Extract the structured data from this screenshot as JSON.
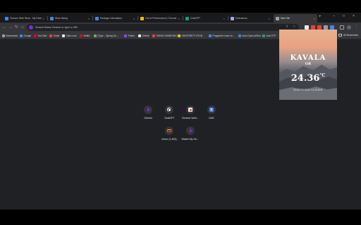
{
  "tabs": [
    {
      "title": "Chrome Web Store - My Exten",
      "color": "#4285f4",
      "active": false
    },
    {
      "title": "Store listing",
      "color": "#4285f4",
      "active": false
    },
    {
      "title": "Package information",
      "color": "#4285f4",
      "active": false
    },
    {
      "title": "Out of Performance | Chrome",
      "color": "#fbbc04",
      "active": false
    },
    {
      "title": "ChatGPT",
      "color": "#10a37f",
      "active": false
    },
    {
      "title": "Extensions",
      "color": "#8ab4f8",
      "active": false
    },
    {
      "title": "New Tab",
      "color": "#9aa0a6",
      "active": true
    }
  ],
  "toolbar": {
    "back": "←",
    "forward": "→",
    "reload": "↻",
    "home": "⌂",
    "omnibox_placeholder": "Search Brave Search or type a URL",
    "share_icon": "⇪",
    "star_icon": "☆",
    "menu_icon": "⋮"
  },
  "extensions": [
    "#e8eaed",
    "#ea4335",
    "#ea4335",
    "#9aa0a6",
    "#4285f4"
  ],
  "bookmarks": [
    {
      "label": "Bookmarks",
      "color": "#9aa0a6"
    },
    {
      "label": "Google",
      "color": "#4285f4"
    },
    {
      "label": "YouTube",
      "color": "#ff0000"
    },
    {
      "label": "Gmail",
      "color": "#ea4335"
    },
    {
      "label": "Claro.com",
      "color": "#e8eaed"
    },
    {
      "label": "Netflix",
      "color": "#e50914"
    },
    {
      "label": "[Type – Spring Gu…",
      "color": "#6db33f"
    },
    {
      "label": "Twitch",
      "color": "#9146ff"
    },
    {
      "label": "GitHub",
      "color": "#e8eaed"
    },
    {
      "label": "TAINIA VIVARIONG…",
      "color": "#ea4335"
    },
    {
      "label": "UNIVERSITY STUD…",
      "color": "#fbbc04"
    },
    {
      "label": "Programiz Learn to…",
      "color": "#4285f4"
    },
    {
      "label": "Ionic Open-uElect…",
      "color": "#3880ff"
    },
    {
      "label": "chat GTP",
      "color": "#10a37f"
    }
  ],
  "all_bookmarks": "All Bookmarks",
  "weather": {
    "city": "KAVALA",
    "country": "GR",
    "temp": "24.36",
    "unit": "°C",
    "condition": "SCATTERED CLOUDS"
  },
  "shortcuts": [
    {
      "label": "Gemini",
      "icon": "play-icon"
    },
    {
      "label": "ChatGPT",
      "icon": "chatgpt-icon"
    },
    {
      "label": "Chrome Web…",
      "icon": "web-store-icon"
    },
    {
      "label": "DUE",
      "icon": "e-icon"
    },
    {
      "label": "Inbox (1,453)",
      "icon": "gmail-icon"
    },
    {
      "label": "Watch My He…",
      "icon": "play-icon"
    }
  ]
}
